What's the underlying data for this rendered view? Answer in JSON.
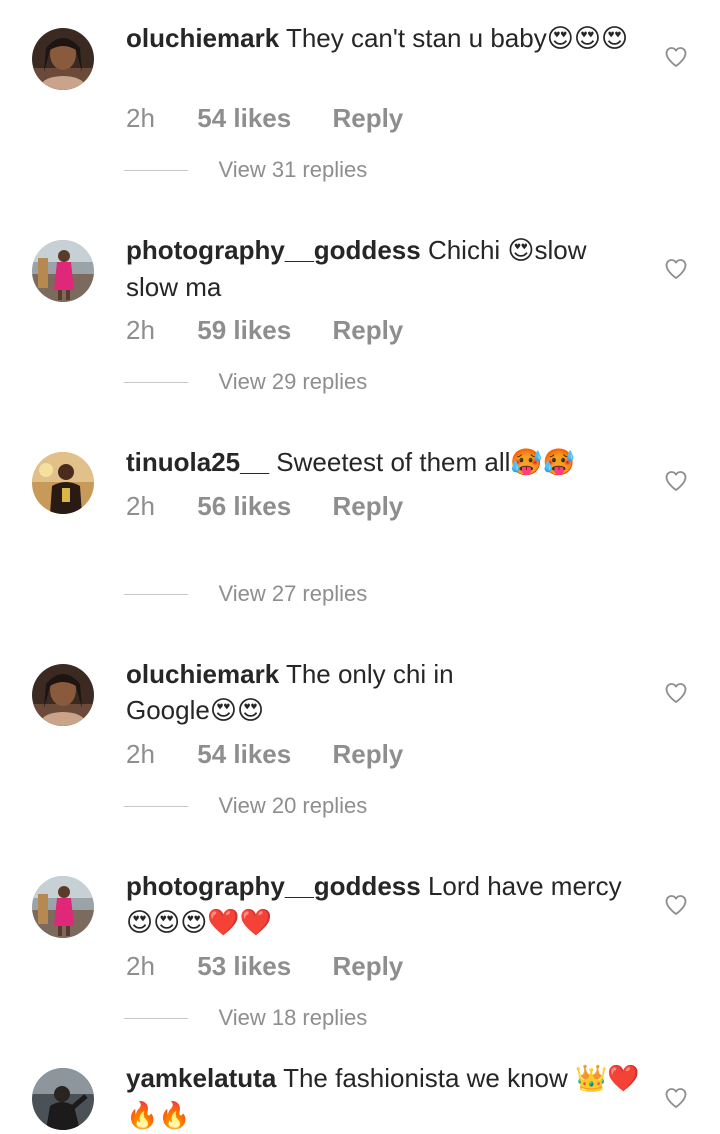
{
  "comments": [
    {
      "username": "oluchiemark",
      "text": "They can't stan u baby",
      "emoji": "😍😍😍",
      "time": "2h",
      "likes": "54 likes",
      "reply": "Reply",
      "view_replies": "View 31 replies",
      "avatar_icon": "avatar-woman"
    },
    {
      "username": "photography__goddess",
      "text": "Chichi ",
      "emoji": "😍",
      "text2": "slow slow ma",
      "time": "2h",
      "likes": "59 likes",
      "reply": "Reply",
      "view_replies": "View 29 replies",
      "avatar_icon": "avatar-pink-dress"
    },
    {
      "username": "tinuola25__",
      "text": "Sweetest of them all",
      "emoji": "🥵🥵",
      "time": "2h",
      "likes": "56 likes",
      "reply": "Reply",
      "view_replies": "View 27 replies",
      "avatar_icon": "avatar-man"
    },
    {
      "username": "oluchiemark",
      "text": "The only chi in Google",
      "emoji": "😍😍",
      "time": "2h",
      "likes": "54 likes",
      "reply": "Reply",
      "view_replies": "View 20 replies",
      "avatar_icon": "avatar-woman"
    },
    {
      "username": "photography__goddess",
      "text": "Lord have mercy",
      "emoji": "😍😍😍❤️❤️",
      "time": "2h",
      "likes": "53 likes",
      "reply": "Reply",
      "view_replies": "View 18 replies",
      "avatar_icon": "avatar-pink-dress"
    },
    {
      "username": "yamkelatuta",
      "text": "The fashionista we know",
      "emoji": "👑❤️🔥🔥",
      "avatar_icon": "avatar-dark"
    }
  ],
  "icons": {
    "like": "heart-outline-icon"
  },
  "colors": {
    "text": "#262626",
    "secondary": "#8e8e8e",
    "divider": "#c7c7c7"
  }
}
